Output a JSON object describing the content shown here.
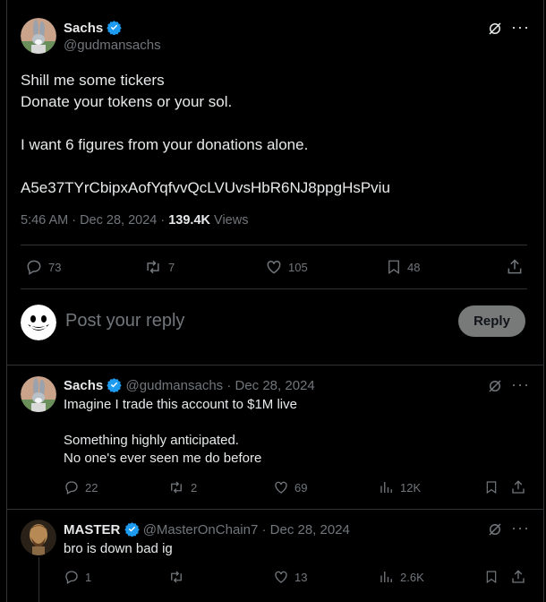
{
  "main_post": {
    "name": "Sachs",
    "handle": "@gudmansachs",
    "lines": [
      "Shill me some tickers",
      "Donate your tokens or your sol.",
      "",
      "I want 6 figures from your donations alone.",
      "",
      "A5e37TYrCbipxAofYqfvvQcLVUvsHbR6NJ8ppgHsPviu"
    ],
    "time": "5:46 AM · Dec 28, 2024 · ",
    "views_count": "139.4K",
    "views_label": " Views",
    "replies": "73",
    "reposts": "7",
    "likes": "105",
    "bookmarks": "48"
  },
  "reply_box": {
    "placeholder": "Post your reply",
    "button": "Reply"
  },
  "replies": [
    {
      "name": "Sachs",
      "handle": "@gudmansachs",
      "date": " · Dec 28, 2024",
      "lines": [
        "Imagine I trade this account to $1M  live",
        "",
        "Something highly anticipated.",
        "No one's ever seen me do before"
      ],
      "replies": "22",
      "reposts": "2",
      "likes": "69",
      "views": "12K"
    },
    {
      "name": "MASTER",
      "handle": "@MasterOnChain7",
      "date": " · Dec 28, 2024",
      "lines": [
        "bro is down bad ig"
      ],
      "replies": "1",
      "reposts": "",
      "likes": "13",
      "views": "2.6K"
    }
  ],
  "colors": {
    "accent": "#1d9bf0",
    "muted": "#71767b",
    "divider": "#2f3336",
    "reply_btn_bg": "#787a7a"
  }
}
